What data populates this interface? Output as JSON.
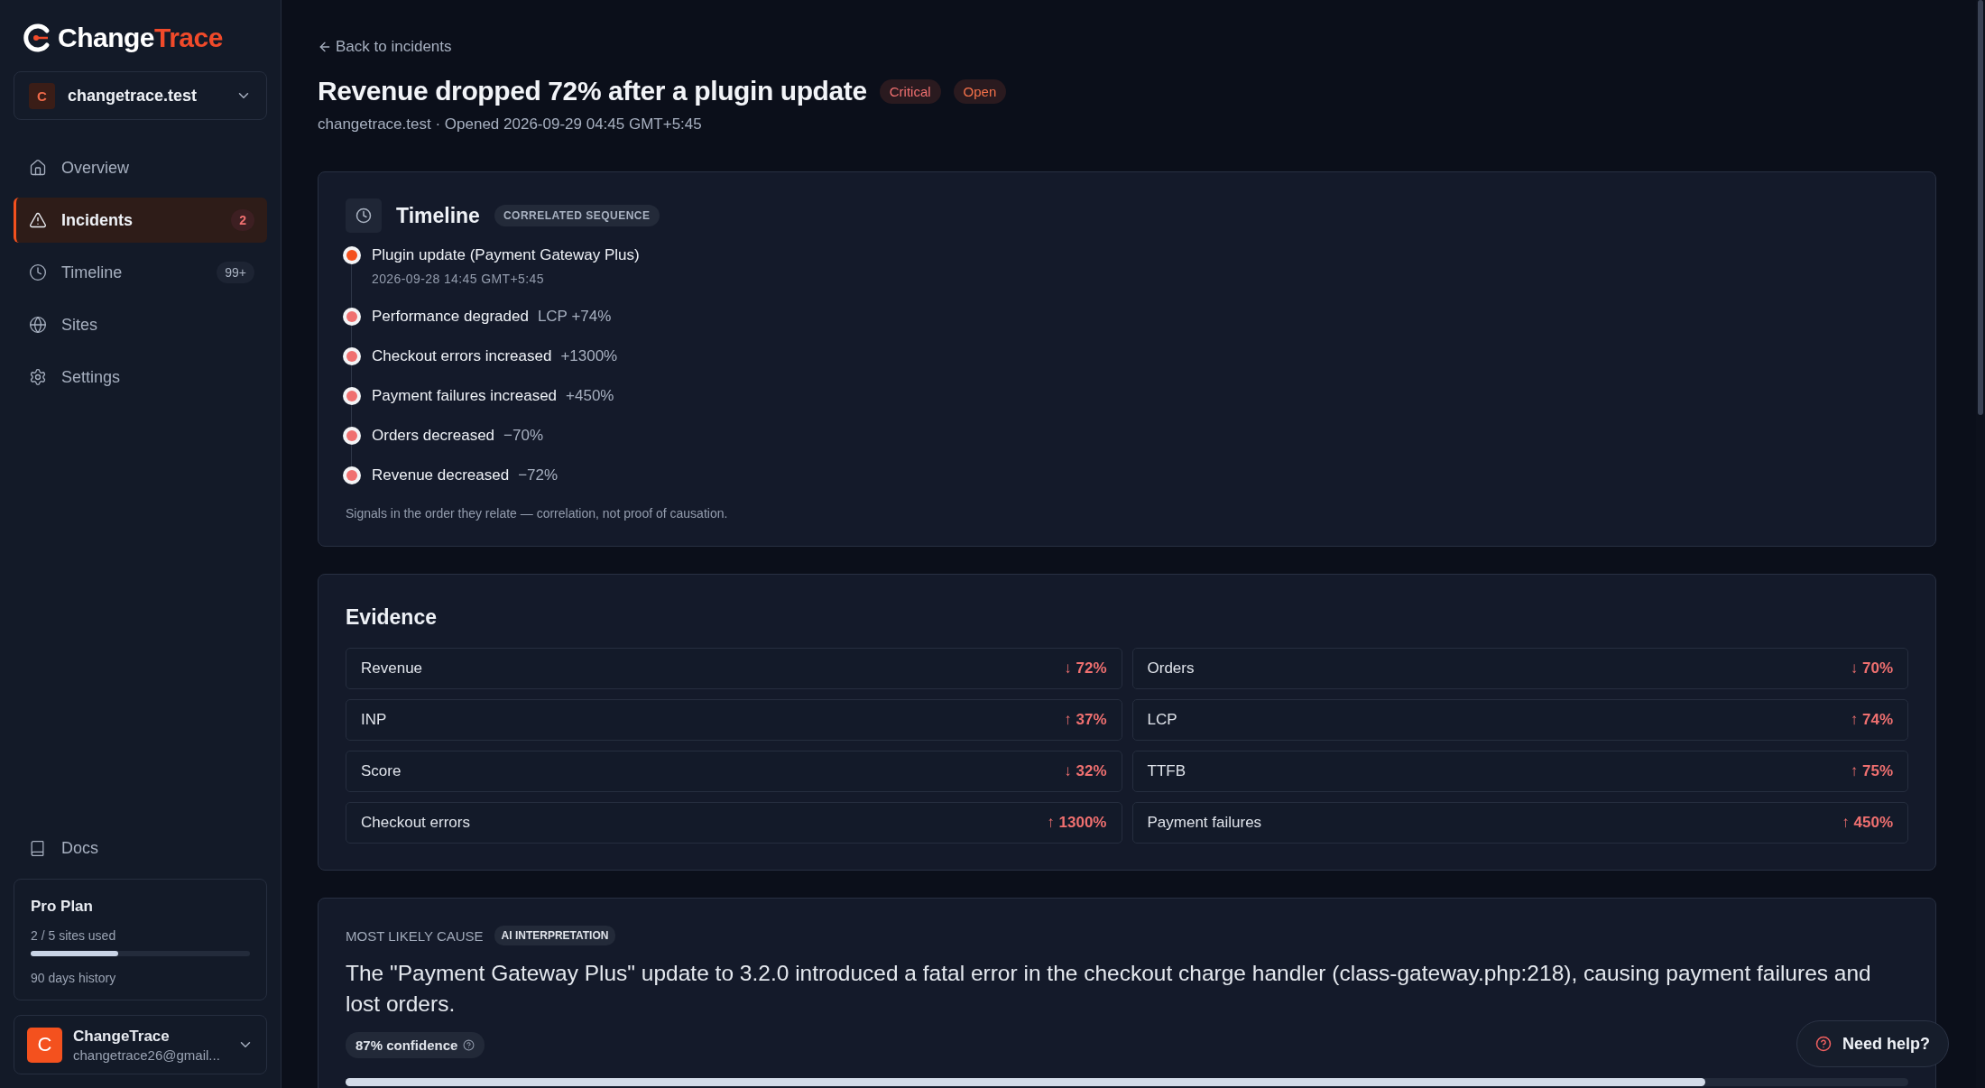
{
  "logo": {
    "first": "Change",
    "second": "Trace"
  },
  "site_selector": {
    "initial": "C",
    "name": "changetrace.test"
  },
  "nav": [
    {
      "label": "Overview",
      "selected": false
    },
    {
      "label": "Incidents",
      "selected": true,
      "badge": "2"
    },
    {
      "label": "Timeline",
      "selected": false,
      "badge": "99+"
    },
    {
      "label": "Sites",
      "selected": false
    },
    {
      "label": "Settings",
      "selected": false
    }
  ],
  "docs_link": "Docs",
  "plan": {
    "title": "Pro Plan",
    "usage": "2 / 5 sites used",
    "level": 0.4,
    "history": "90 days history"
  },
  "account": {
    "initial": "C",
    "name": "ChangeTrace",
    "email": "changetrace26@gmail..."
  },
  "back_link": "Back to incidents",
  "incident": {
    "title": "Revenue dropped 72% after a plugin update",
    "severity": "Critical",
    "status": "Open",
    "meta": "changetrace.test · Opened 2026-09-29 04:45 GMT+5:45"
  },
  "timeline": {
    "title": "Timeline",
    "tag": "CORRELATED SEQUENCE",
    "events": [
      {
        "label": "Plugin update (Payment Gateway Plus)",
        "time": "2026-09-28 14:45 GMT+5:45",
        "color": "#f4511e"
      },
      {
        "label": "Performance degraded",
        "delta": "LCP +74%",
        "color": "#f07070"
      },
      {
        "label": "Checkout errors increased",
        "delta": "+1300%",
        "color": "#f07070"
      },
      {
        "label": "Payment failures increased",
        "delta": "+450%",
        "color": "#f07070"
      },
      {
        "label": "Orders decreased",
        "delta": "−70%",
        "color": "#f07070"
      },
      {
        "label": "Revenue decreased",
        "delta": "−72%",
        "color": "#f07070"
      }
    ],
    "note": "Signals in the order they relate — correlation, not proof of causation."
  },
  "evidence": {
    "title": "Evidence",
    "items": [
      {
        "label": "Revenue",
        "value": "↓ 72%"
      },
      {
        "label": "Orders",
        "value": "↓ 70%"
      },
      {
        "label": "INP",
        "value": "↑ 37%"
      },
      {
        "label": "LCP",
        "value": "↑ 74%"
      },
      {
        "label": "Score",
        "value": "↓ 32%"
      },
      {
        "label": "TTFB",
        "value": "↑ 75%"
      },
      {
        "label": "Checkout errors",
        "value": "↑ 1300%"
      },
      {
        "label": "Payment failures",
        "value": "↑ 450%"
      }
    ]
  },
  "cause": {
    "label": "MOST LIKELY CAUSE",
    "tag": "AI INTERPRETATION",
    "text": "The \"Payment Gateway Plus\" update to 3.2.0 introduced a fatal error in the checkout charge handler (class-gateway.php:218), causing payment failures and lost orders.",
    "confidence": "87% confidence",
    "level": 0.87
  },
  "help_button": "Need help?"
}
